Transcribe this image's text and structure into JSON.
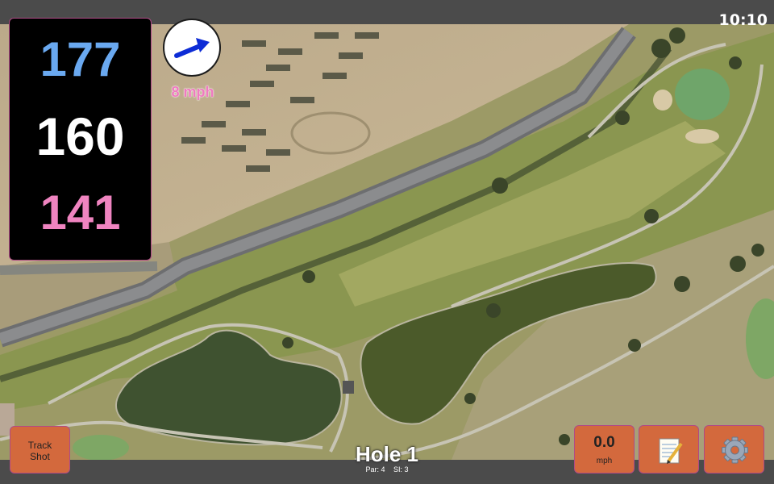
{
  "status_bar": {
    "time": "10:10"
  },
  "distances": {
    "back": "177",
    "middle": "160",
    "front": "141"
  },
  "wind": {
    "speed_label": "8 mph",
    "icon": "wind-direction-arrow-icon"
  },
  "buttons": {
    "track_shot_line1": "Track",
    "track_shot_line2": "Shot",
    "speed_value": "0.0",
    "speed_unit": "mph",
    "notes_icon": "notepad-icon",
    "settings_icon": "gear-icon"
  },
  "hole": {
    "title": "Hole 1",
    "par": "Par: 4",
    "si": "SI: 3"
  },
  "colors": {
    "back_distance": "#6aa9f0",
    "middle_distance": "#ffffff",
    "front_distance": "#ef84c0",
    "button_bg": "#d3693d",
    "wind_label": "#f07ac0"
  }
}
